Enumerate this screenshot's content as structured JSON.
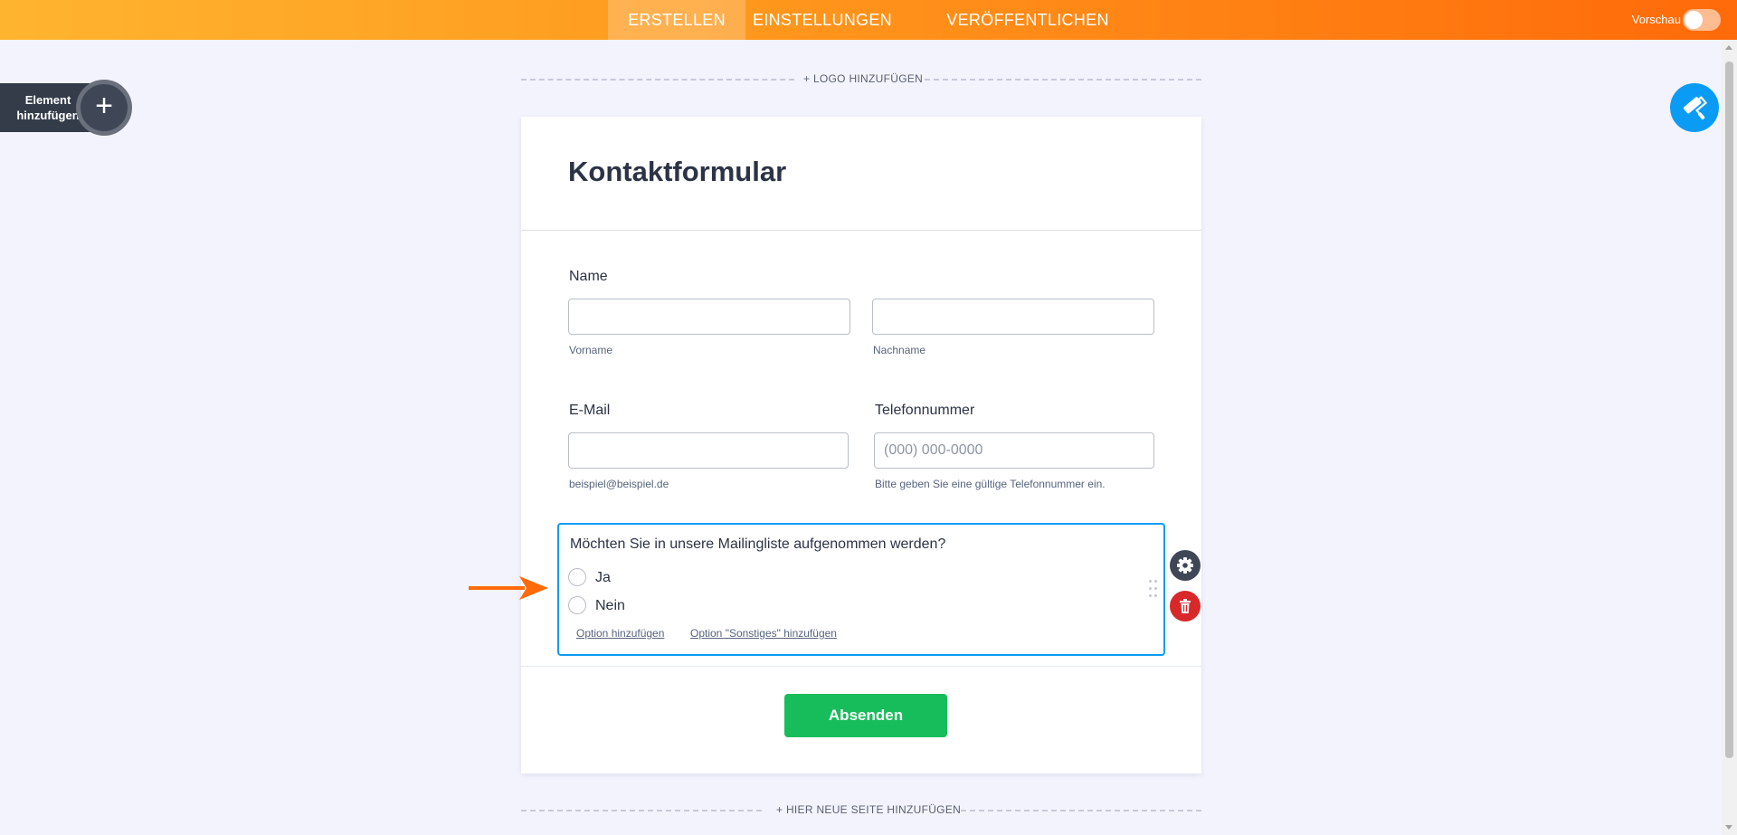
{
  "topbar": {
    "tabs": [
      {
        "label": "ERSTELLEN",
        "active": true
      },
      {
        "label": "EINSTELLUNGEN",
        "active": false
      },
      {
        "label": "VERÖFFENTLICHEN",
        "active": false
      }
    ],
    "preview_label": "Vorschau",
    "preview_enabled": false
  },
  "sidebar": {
    "add_element_label": "Element hinzufügen",
    "add_icon": "plus-icon"
  },
  "canvas": {
    "add_logo_label": "+ LOGO HINZUFÜGEN",
    "add_page_label": "+ HIER NEUE SEITE HINZUFÜGEN",
    "paint_icon": "paint-roller-icon"
  },
  "form": {
    "title": "Kontaktformular",
    "name": {
      "label": "Name",
      "first": {
        "value": "",
        "placeholder": "",
        "sublabel": "Vorname"
      },
      "last": {
        "value": "",
        "placeholder": "",
        "sublabel": "Nachname"
      }
    },
    "email": {
      "label": "E-Mail",
      "value": "",
      "placeholder": "",
      "sublabel": "beispiel@beispiel.de"
    },
    "phone": {
      "label": "Telefonnummer",
      "value": "",
      "placeholder": "(000) 000-0000",
      "sublabel": "Bitte geben Sie eine gültige Telefonnummer ein."
    },
    "question": {
      "text": "Möchten Sie in unsere Mailingliste aufgenommen werden?",
      "options": [
        "Ja",
        "Nein"
      ],
      "add_option_link": "Option hinzufügen",
      "add_other_link": "Option \"Sonstiges\" hinzufügen"
    },
    "submit_label": "Absenden"
  },
  "colors": {
    "accent_orange": "#ff6a0a",
    "selection_blue": "#0a9cf5",
    "submit_green": "#18bd5b",
    "delete_red": "#d8282a"
  }
}
